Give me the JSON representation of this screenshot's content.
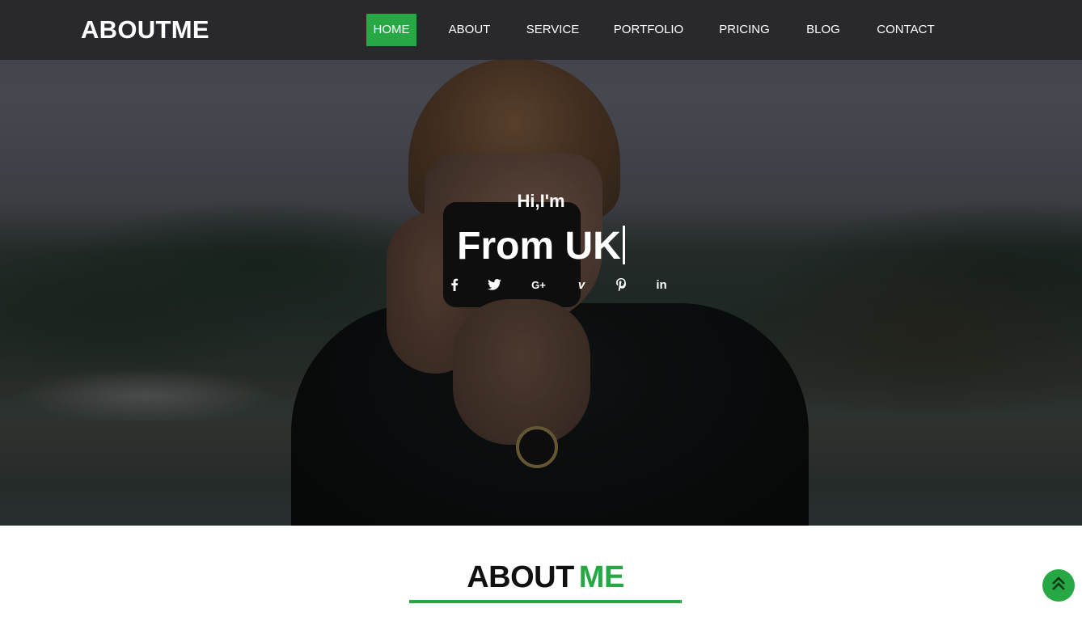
{
  "brand": "ABOUTME",
  "nav": {
    "items": [
      {
        "label": "HOME",
        "active": true
      },
      {
        "label": "ABOUT",
        "active": false
      },
      {
        "label": "SERVICE",
        "active": false
      },
      {
        "label": "PORTFOLIO",
        "active": false
      },
      {
        "label": "PRICING",
        "active": false
      },
      {
        "label": "BLOG",
        "active": false
      },
      {
        "label": "CONTACT",
        "active": false
      }
    ]
  },
  "hero": {
    "greeting": "Hi,I'm",
    "headline": "From UK",
    "social_icons": [
      "facebook-icon",
      "twitter-icon",
      "google-plus-icon",
      "vimeo-icon",
      "pinterest-icon",
      "linkedin-icon"
    ],
    "social_glyphs": {
      "gplus": "G+",
      "vimeo": "v",
      "linkedin": "in"
    }
  },
  "about": {
    "title_part1": "ABOUT",
    "title_part2": "ME"
  },
  "back_to_top_icon": "double-chevron-up-icon",
  "colors": {
    "accent": "#28a745",
    "navbar_bg": "#28282c",
    "text_light": "#ffffff",
    "text_dark": "#111111"
  }
}
